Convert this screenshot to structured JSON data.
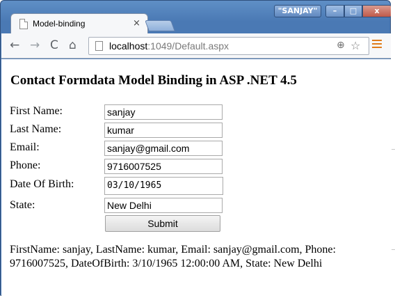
{
  "titlebar": {
    "profile": "\"SANJAY\"",
    "minimize": "–",
    "maximize": "□",
    "close": "x"
  },
  "tab": {
    "title": "Model-binding",
    "close": "×"
  },
  "toolbar": {
    "back": "←",
    "forward": "→",
    "reload": "C",
    "home": "⌂",
    "url_host": "localhost",
    "url_rest": ":1049/Default.aspx",
    "zoom": "⊕",
    "star": "☆"
  },
  "page": {
    "title": "Contact Formdata Model Binding in ASP .NET 4.5",
    "form": {
      "first_name_label": "First Name:",
      "first_name": "sanjay",
      "last_name_label": "Last Name:",
      "last_name": "kumar",
      "email_label": "Email:",
      "email": "sanjay@gmail.com",
      "phone_label": "Phone:",
      "phone": "9716007525",
      "dob_label": "Date Of Birth:",
      "dob": "03/10/1965",
      "state_label": "State:",
      "state": "New Delhi",
      "submit": "Submit"
    },
    "result": "FirstName: sanjay, LastName: kumar, Email: sanjay@gmail.com, Phone: 9716007525, DateOfBirth: 3/10/1965 12:00:00 AM, State: New Delhi"
  }
}
